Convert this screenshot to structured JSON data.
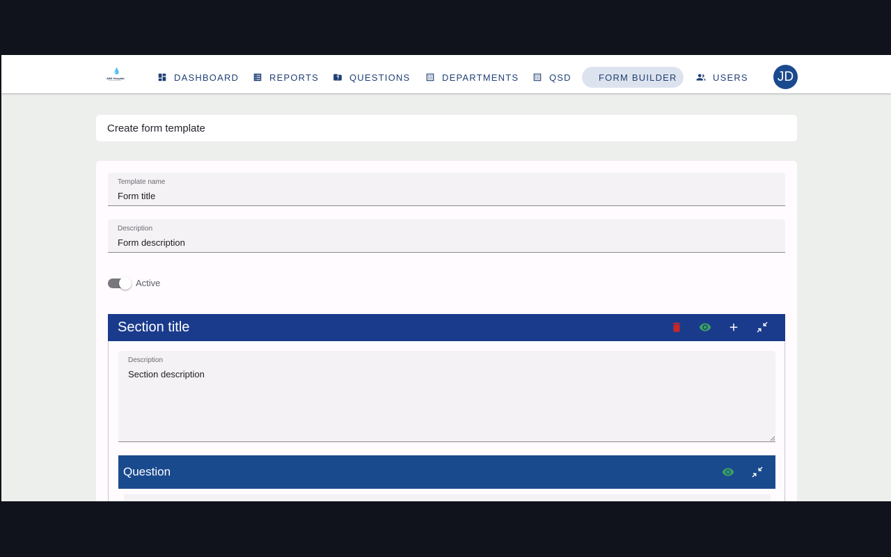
{
  "app": {
    "logo_text": "ABK Hospital",
    "nav": [
      {
        "label": "DASHBOARD",
        "icon": "dashboard-icon",
        "active": false
      },
      {
        "label": "REPORTS",
        "icon": "list-icon",
        "active": false
      },
      {
        "label": "QUESTIONS",
        "icon": "folder-question-icon",
        "active": false
      },
      {
        "label": "DEPARTMENTS",
        "icon": "grid-dots-icon",
        "active": false
      },
      {
        "label": "QSD",
        "icon": "grid-dots-icon",
        "active": false
      },
      {
        "label": "FORM BUILDER",
        "icon": "form-icon",
        "active": true
      },
      {
        "label": "USERS",
        "icon": "users-icon",
        "active": false
      }
    ],
    "user_initials": "JD"
  },
  "page": {
    "title": "Create form template"
  },
  "form": {
    "template_name": {
      "label": "Template name",
      "value": "Form title"
    },
    "description": {
      "label": "Description",
      "value": "Form description"
    },
    "active_label": "Active",
    "active": true
  },
  "section": {
    "title": "Section title",
    "description": {
      "label": "Description",
      "value": "Section description"
    },
    "icons": [
      "delete-icon",
      "preview-icon",
      "add-icon",
      "collapse-icon"
    ],
    "colors": {
      "header": "#1a3b8c",
      "delete": "#c62828",
      "preview": "#3aa55d"
    }
  },
  "question": {
    "title": "Question",
    "icons": [
      "preview-icon",
      "collapse-icon"
    ],
    "colors": {
      "header": "#1a4a8e"
    }
  }
}
